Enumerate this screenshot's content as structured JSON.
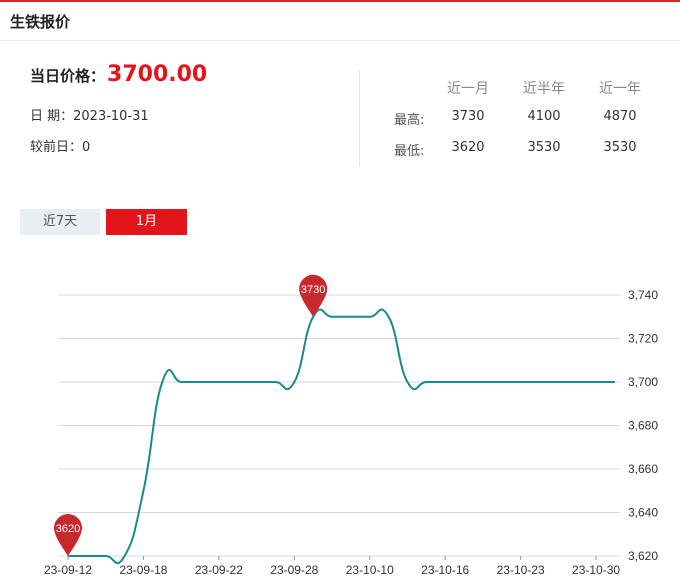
{
  "header": {
    "title": "生铁报价"
  },
  "summary": {
    "price_label": "当日价格：",
    "price_value": "3700.00",
    "date_text": "日 期：2023-10-31",
    "change_text": "较前日：0"
  },
  "stats": {
    "columns": [
      "近一月",
      "近半年",
      "近一年"
    ],
    "rows": [
      {
        "label": "最高:",
        "values": [
          "3730",
          "4100",
          "4870"
        ]
      },
      {
        "label": "最低:",
        "values": [
          "3620",
          "3530",
          "3530"
        ]
      }
    ]
  },
  "tabs": [
    {
      "label": "近7天",
      "active": false
    },
    {
      "label": "1月",
      "active": true
    }
  ],
  "colors": {
    "accent": "#e3141b",
    "line": "#1a8a8a",
    "marker": "#c8292e"
  },
  "chart_data": {
    "type": "line",
    "x_tick_labels": [
      "23-09-12",
      "23-09-18",
      "23-09-22",
      "23-09-28",
      "23-10-10",
      "23-10-16",
      "23-10-23",
      "23-10-30"
    ],
    "y_tick_labels": [
      "3,620",
      "3,640",
      "3,660",
      "3,680",
      "3,700",
      "3,720",
      "3,740"
    ],
    "ylim": [
      3620,
      3740
    ],
    "grid": true,
    "y_axis_side": "right",
    "series": [
      {
        "points": [
          [
            "23-09-12",
            3620
          ],
          [
            "23-09-13",
            3620
          ],
          [
            "23-09-14",
            3620
          ],
          [
            "23-09-15",
            3620
          ],
          [
            "23-09-18",
            3650
          ],
          [
            "23-09-19",
            3700
          ],
          [
            "23-09-20",
            3700
          ],
          [
            "23-09-21",
            3700
          ],
          [
            "23-09-22",
            3700
          ],
          [
            "23-09-25",
            3700
          ],
          [
            "23-09-26",
            3700
          ],
          [
            "23-09-27",
            3700
          ],
          [
            "23-09-28",
            3700
          ],
          [
            "23-10-09",
            3730
          ],
          [
            "23-10-10",
            3730
          ],
          [
            "23-10-11",
            3730
          ],
          [
            "23-10-12",
            3730
          ],
          [
            "23-10-13",
            3730
          ],
          [
            "23-10-16",
            3700
          ],
          [
            "23-10-17",
            3700
          ],
          [
            "23-10-18",
            3700
          ],
          [
            "23-10-19",
            3700
          ],
          [
            "23-10-20",
            3700
          ],
          [
            "23-10-23",
            3700
          ],
          [
            "23-10-24",
            3700
          ],
          [
            "23-10-25",
            3700
          ],
          [
            "23-10-26",
            3700
          ],
          [
            "23-10-27",
            3700
          ],
          [
            "23-10-30",
            3700
          ],
          [
            "23-10-31",
            3700
          ]
        ]
      }
    ],
    "markers": [
      {
        "date": "23-09-12",
        "value": 3620,
        "label": "3620"
      },
      {
        "date": "23-10-09",
        "value": 3730,
        "label": "3730"
      }
    ]
  }
}
